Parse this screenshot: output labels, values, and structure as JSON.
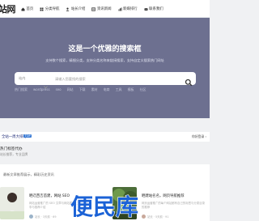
{
  "nav": {
    "logo": "站网",
    "items": [
      {
        "label": "首页",
        "icon": "home-icon"
      },
      {
        "label": "分类导航",
        "icon": "grid-icon"
      },
      {
        "label": "站长介绍",
        "icon": "user-icon"
      },
      {
        "label": "资讯新闻",
        "icon": "news-icon"
      },
      {
        "label": "新媒排行",
        "icon": "chart-icon"
      },
      {
        "label": "联系我们",
        "icon": "contact-icon"
      }
    ]
  },
  "hero": {
    "title": "这是一个优雅的搜索框",
    "subtitle": "支持数个搜索，精细分类，支持分类名称来链接搜索，支持自定义搜索热门网址",
    "search": {
      "category": "站内",
      "placeholder": "请输入您要找的搜索"
    },
    "hot_tags": [
      "热门搜索",
      "wordpress",
      "seo",
      "网站",
      "下载",
      "素材",
      "电商",
      "工具",
      "模板",
      "社区"
    ]
  },
  "bar": {
    "title": "全站一周大排行",
    "badge": "TOP",
    "right": "你好登录 ›"
  },
  "widget": {
    "title": "热门标签代办",
    "desc": "站长推荐，专业品牌"
  },
  "cards": {
    "heading": "最新文章推荐展示，精彩历史资讯",
    "items": [
      {
        "title": "晒迁西吉首建，网站 SEO",
        "meta": "网站运营推广的 SEO 文章与网站建设工作内容的分享与推荐介绍",
        "stats": "站长  ·  3天前  ·  69"
      },
      {
        "title": "晒建站名名，网页导航推荐",
        "meta": "网页运营推广的每个网站都有自己的标签与分类目录的推荐",
        "stats": "站长  ·  5天前  ·  91"
      }
    ]
  },
  "watermark": {
    "text": "便民库"
  },
  "colors": {
    "hero_bg": "#6d7090",
    "accent": "#1e2b78",
    "badge": "#3a7bd5",
    "watermark": "#1b62d6"
  }
}
